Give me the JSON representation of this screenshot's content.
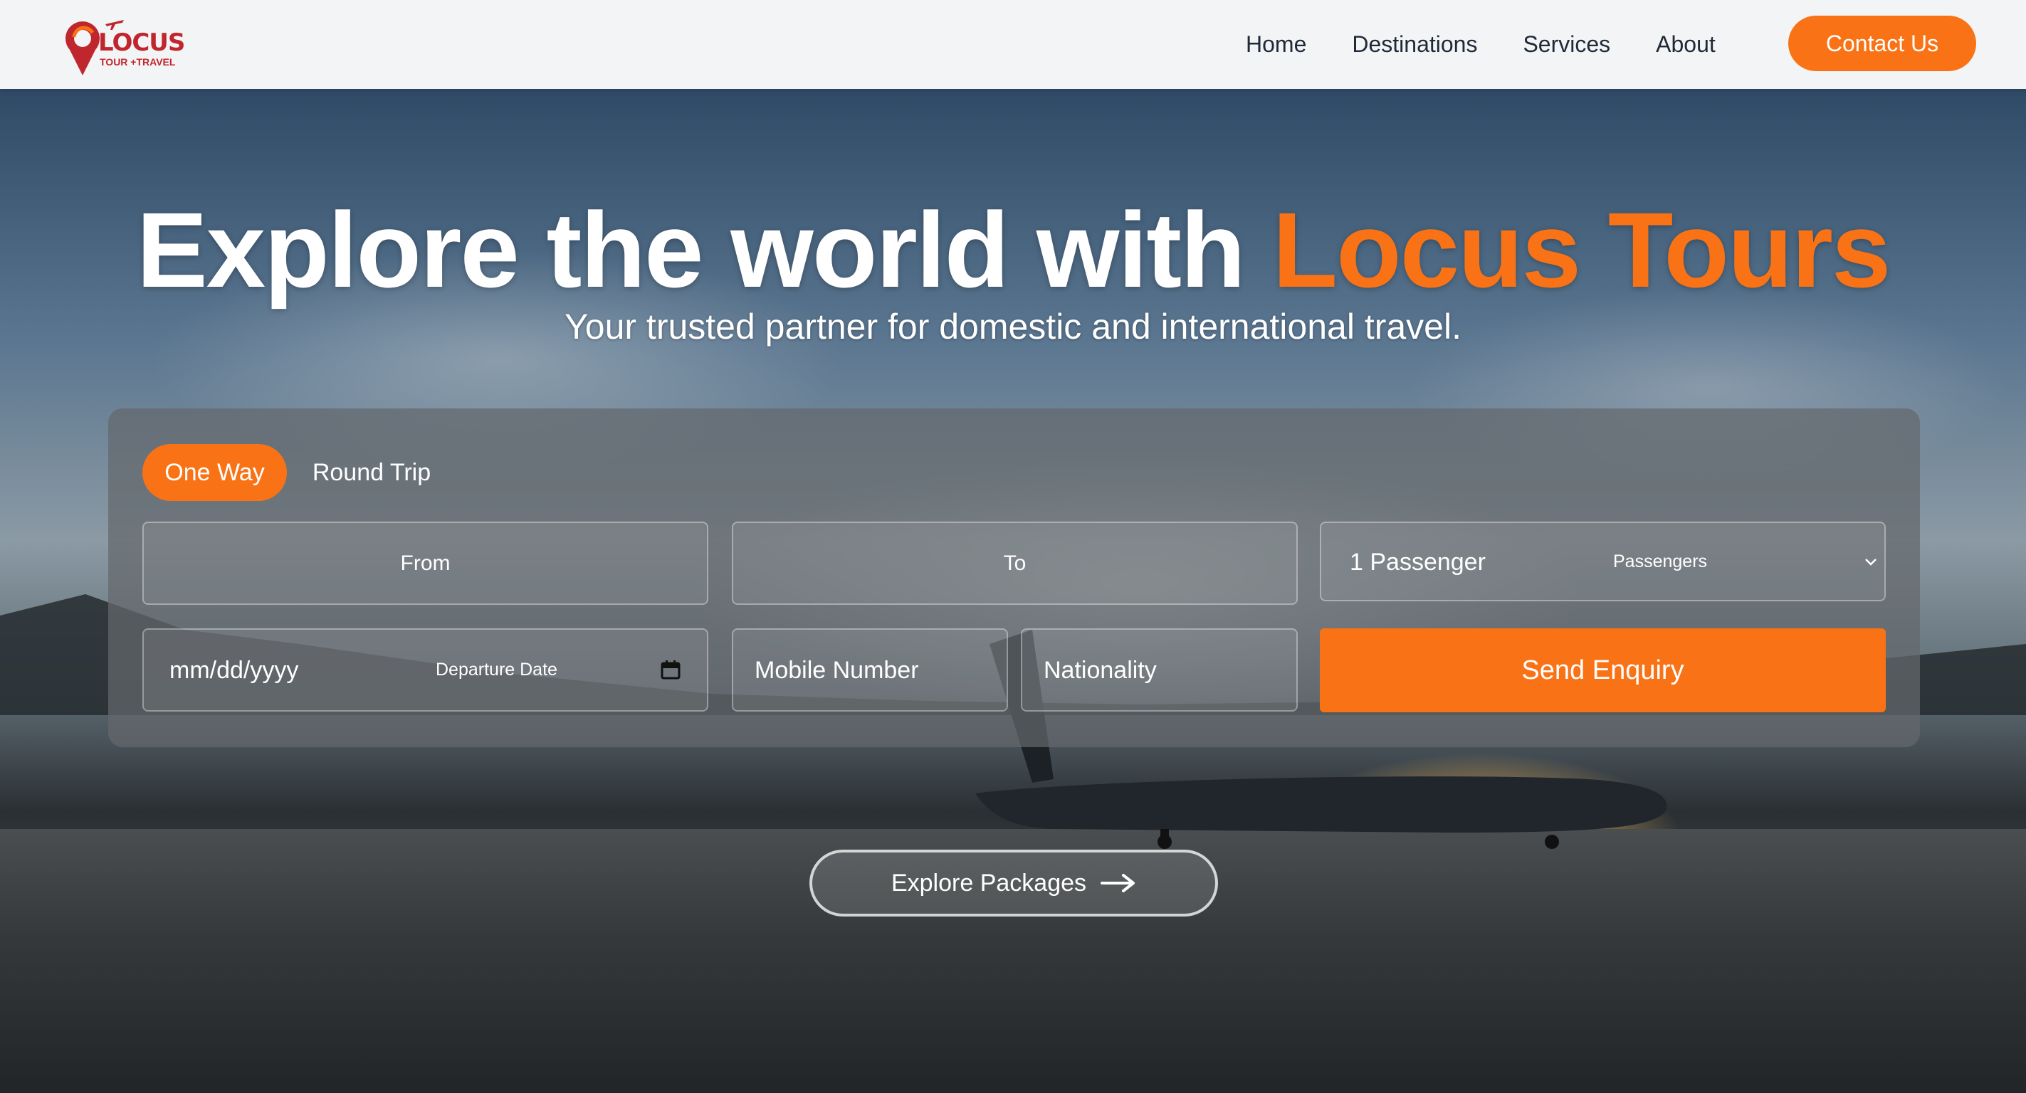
{
  "brand": {
    "name": "LOCUS",
    "tagline": "TOUR +TRAVEL"
  },
  "nav": {
    "links": [
      {
        "label": "Home"
      },
      {
        "label": "Destinations"
      },
      {
        "label": "Services"
      },
      {
        "label": "About"
      }
    ],
    "contact_label": "Contact Us"
  },
  "hero": {
    "title_prefix": "Explore the world with ",
    "title_accent": "Locus Tours",
    "subtitle": "Your trusted partner for domestic and international travel."
  },
  "search": {
    "tabs": {
      "one_way": "One Way",
      "round_trip": "Round Trip"
    },
    "from_label": "From",
    "to_label": "To",
    "passengers": {
      "value": "1 Passenger",
      "label": "Passengers"
    },
    "date": {
      "value": "mm/dd/yyyy",
      "label": "Departure Date"
    },
    "mobile_placeholder": "Mobile Number",
    "nationality_placeholder": "Nationality",
    "submit_label": "Send Enquiry"
  },
  "cta": {
    "explore_label": "Explore Packages"
  },
  "colors": {
    "accent": "#f97316",
    "brand_red": "#c0262d"
  }
}
